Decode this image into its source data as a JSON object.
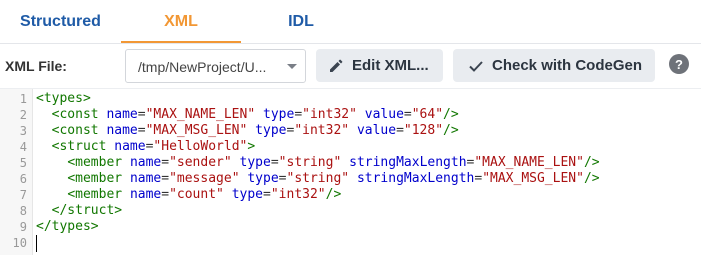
{
  "tabs": [
    {
      "label": "Structured"
    },
    {
      "label": "XML"
    },
    {
      "label": "IDL"
    }
  ],
  "colors": {
    "active_tab": "#f29734",
    "inactive_tab": "#1f5ba7"
  },
  "toolbar": {
    "file_label": "XML File:",
    "file_value": "/tmp/NewProject/U...",
    "edit_button_label": "Edit XML...",
    "edit_icon": "pencil-icon",
    "check_button_label": "Check with CodeGen",
    "check_icon": "checkmark-icon",
    "help_icon": "help-icon",
    "help_glyph": "?"
  },
  "editor": {
    "line_numbers": [
      "1",
      "2",
      "3",
      "4",
      "5",
      "6",
      "7",
      "8",
      "9",
      "10"
    ],
    "lines": [
      "<types>",
      "  <const name=\"MAX_NAME_LEN\" type=\"int32\" value=\"64\"/>",
      "  <const name=\"MAX_MSG_LEN\" type=\"int32\" value=\"128\"/>",
      "  <struct name=\"HelloWorld\">",
      "    <member name=\"sender\" type=\"string\" stringMaxLength=\"MAX_NAME_LEN\"/>",
      "    <member name=\"message\" type=\"string\" stringMaxLength=\"MAX_MSG_LEN\"/>",
      "    <member name=\"count\" type=\"int32\"/>",
      "  </struct>",
      "</types>",
      ""
    ]
  }
}
